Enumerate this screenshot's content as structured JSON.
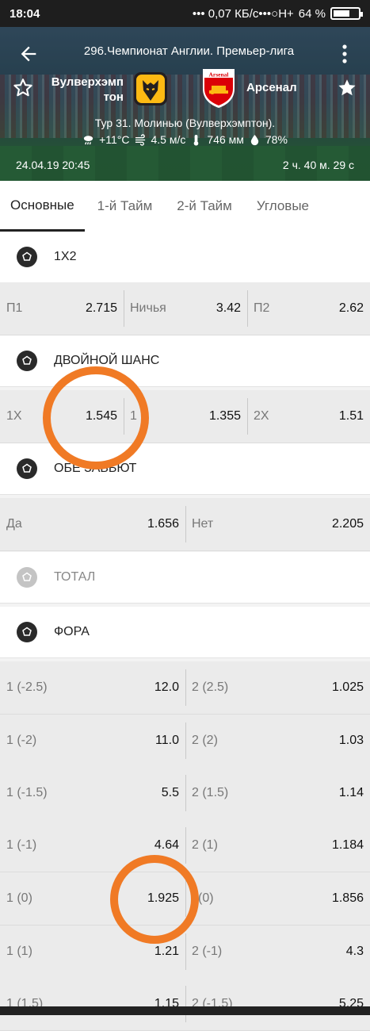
{
  "status_bar": {
    "time": "18:04",
    "network": "••• 0,07 КБ/с•••○H+",
    "battery": "64 %"
  },
  "header": {
    "league": "296.Чемпионат Англии. Премьер-лига",
    "team_home": "Вулверхэмп\nтон",
    "team_away": "Арсенал",
    "venue": "Тур 31. Молинью (Вулверхэмптон).",
    "weather": {
      "temp": "+11°C",
      "wind": "4.5 м/с",
      "pressure": "746 мм",
      "humidity": "78%"
    },
    "datetime": "24.04.19 20:45",
    "countdown": "2 ч. 40 м. 29 с"
  },
  "tabs": [
    {
      "label": "Основные",
      "active": true
    },
    {
      "label": "1-й Тайм",
      "active": false
    },
    {
      "label": "2-й Тайм",
      "active": false
    },
    {
      "label": "Угловые",
      "active": false
    }
  ],
  "markets": {
    "x12": {
      "title": "1X2",
      "row": [
        {
          "label": "П1",
          "value": "2.715"
        },
        {
          "label": "Ничья",
          "value": "3.42"
        },
        {
          "label": "П2",
          "value": "2.62"
        }
      ]
    },
    "double_chance": {
      "title": "ДВОЙНОЙ ШАНС",
      "row": [
        {
          "label": "1X",
          "value": "1.545"
        },
        {
          "label": "1",
          "value": "1.355"
        },
        {
          "label": "2X",
          "value": "1.51"
        }
      ]
    },
    "both_score": {
      "title": "ОБЕ ЗАБЬЮТ",
      "row": [
        {
          "label": "Да",
          "value": "1.656"
        },
        {
          "label": "Нет",
          "value": "2.205"
        }
      ]
    },
    "total": {
      "title": "ТОТАЛ"
    },
    "handicap": {
      "title": "ФОРА",
      "rows": [
        [
          {
            "label": "1 (-2.5)",
            "value": "12.0"
          },
          {
            "label": "2 (2.5)",
            "value": "1.025"
          }
        ],
        [
          {
            "label": "1 (-2)",
            "value": "11.0"
          },
          {
            "label": "2 (2)",
            "value": "1.03"
          }
        ],
        [
          {
            "label": "1 (-1.5)",
            "value": "5.5"
          },
          {
            "label": "2 (1.5)",
            "value": "1.14"
          }
        ],
        [
          {
            "label": "1 (-1)",
            "value": "4.64"
          },
          {
            "label": "2 (1)",
            "value": "1.184"
          }
        ],
        [
          {
            "label": "1 (0)",
            "value": "1.925"
          },
          {
            "label": "(0)",
            "value": "1.856"
          }
        ],
        [
          {
            "label": "1 (1)",
            "value": "1.21"
          },
          {
            "label": "2 (-1)",
            "value": "4.3"
          }
        ],
        [
          {
            "label": "1 (1.5)",
            "value": "1.15"
          },
          {
            "label": "2 (-1.5)",
            "value": "5.25"
          }
        ]
      ]
    }
  },
  "colors": {
    "highlight": "#f07a25",
    "arsenal_red": "#db0007",
    "wolves_gold": "#fdb913"
  }
}
